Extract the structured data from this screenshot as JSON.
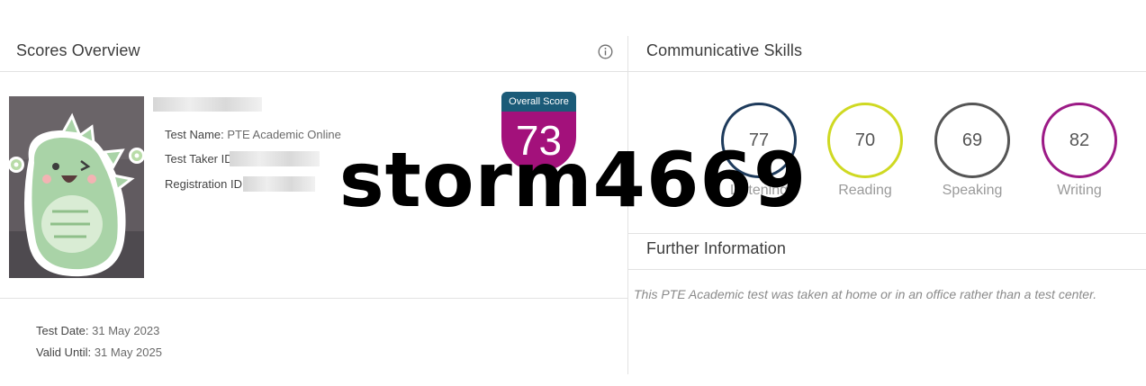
{
  "scores_overview": {
    "title": "Scores Overview",
    "info_icon": "info-circle-icon",
    "photo_icon": "dinosaur-sticker-photo",
    "fields": {
      "test_name_label": "Test Name:",
      "test_name_value": "PTE Academic Online",
      "taker_id_label": "Test Taker ID",
      "registration_id_label": "Registration ID"
    },
    "overall": {
      "label": "Overall Score",
      "value": "73",
      "header_color": "#1b5b78",
      "badge_color": "#a3117b"
    },
    "test_date_label": "Test Date:",
    "test_date_value": "31 May 2023",
    "valid_until_label": "Valid Until:",
    "valid_until_value": "31 May 2025"
  },
  "communicative_skills": {
    "title": "Communicative Skills",
    "skills": [
      {
        "name": "Listening",
        "score": "77",
        "color": "#1e3b5c"
      },
      {
        "name": "Reading",
        "score": "70",
        "color": "#cfd922"
      },
      {
        "name": "Speaking",
        "score": "69",
        "color": "#555555"
      },
      {
        "name": "Writing",
        "score": "82",
        "color": "#9c1a86"
      }
    ]
  },
  "further_information": {
    "title": "Further Information",
    "note": "This PTE Academic test was taken at home or in an office rather than a test center."
  },
  "watermark": "storm4669"
}
